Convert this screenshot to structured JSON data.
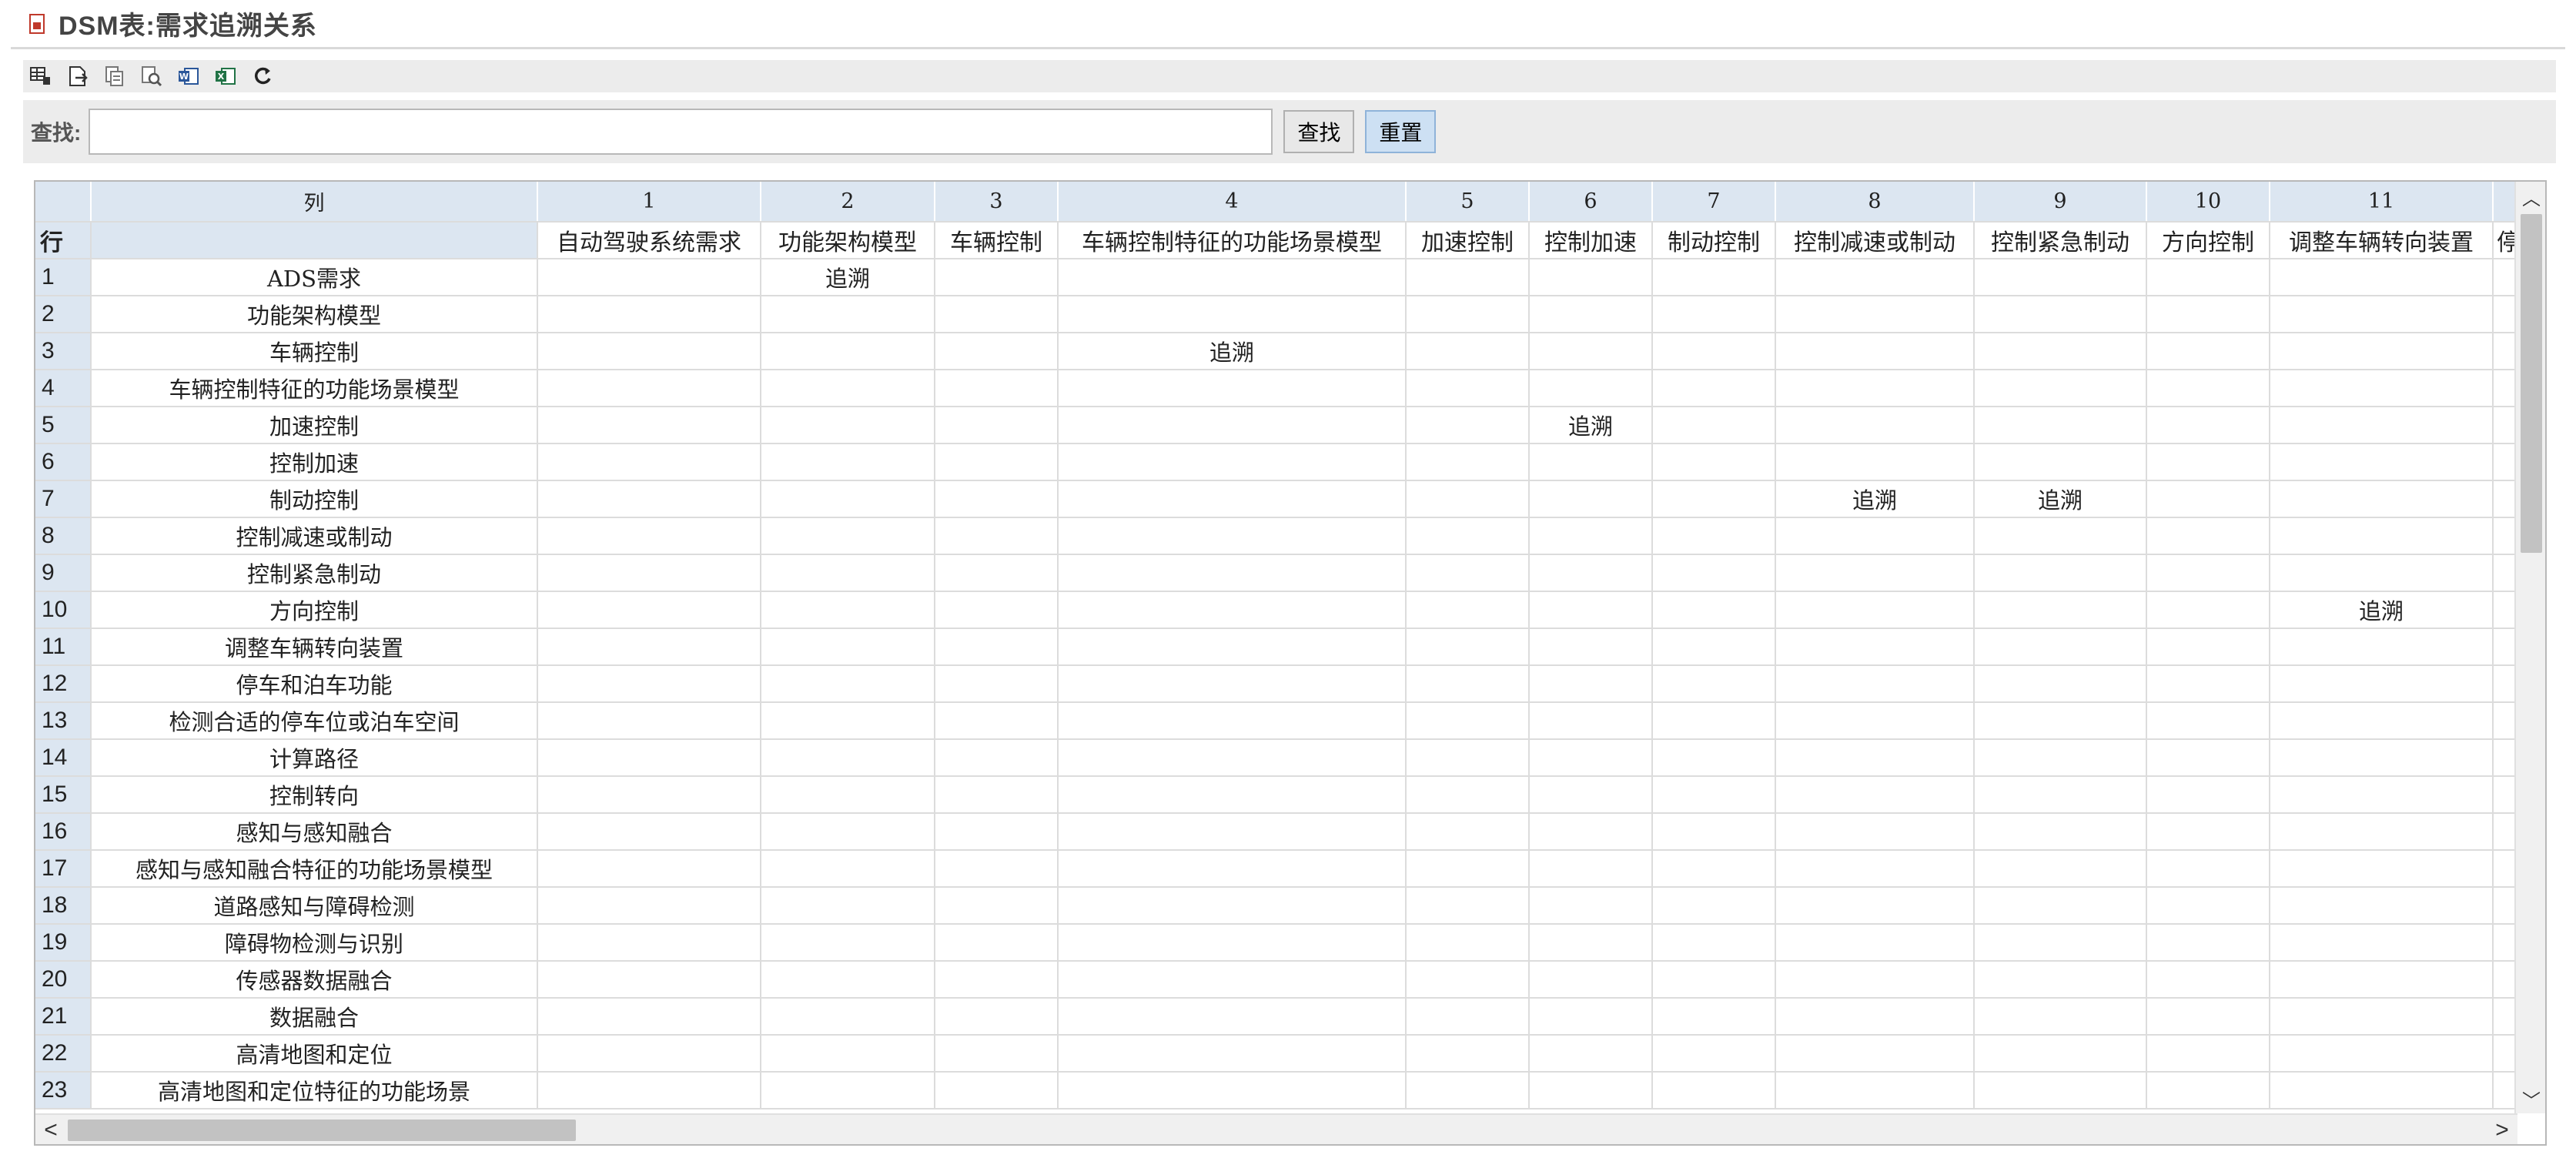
{
  "window": {
    "title": "DSM表:需求追溯关系"
  },
  "toolbar": {
    "icons": [
      "table-grid-icon",
      "export-icon",
      "copy-icon",
      "find-icon",
      "word-icon",
      "excel-icon",
      "refresh-icon"
    ]
  },
  "search": {
    "label": "查找:",
    "value": "",
    "find_label": "查找",
    "reset_label": "重置"
  },
  "grid": {
    "column_header_label": "列",
    "row_header_label": "行",
    "columns": [
      {
        "num": "1",
        "name": "自动驾驶系统需求"
      },
      {
        "num": "2",
        "name": "功能架构模型"
      },
      {
        "num": "3",
        "name": "车辆控制"
      },
      {
        "num": "4",
        "name": "车辆控制特征的功能场景模型"
      },
      {
        "num": "5",
        "name": "加速控制"
      },
      {
        "num": "6",
        "name": "控制加速"
      },
      {
        "num": "7",
        "name": "制动控制"
      },
      {
        "num": "8",
        "name": "控制减速或制动"
      },
      {
        "num": "9",
        "name": "控制紧急制动"
      },
      {
        "num": "10",
        "name": "方向控制"
      },
      {
        "num": "11",
        "name": "调整车辆转向装置"
      },
      {
        "num": "",
        "name": "停"
      }
    ],
    "rows": [
      {
        "num": "1",
        "name": "ADS需求",
        "cells": [
          "",
          "追溯",
          "",
          "",
          "",
          "",
          "",
          "",
          "",
          "",
          "",
          ""
        ]
      },
      {
        "num": "2",
        "name": "功能架构模型",
        "cells": [
          "",
          "",
          "",
          "",
          "",
          "",
          "",
          "",
          "",
          "",
          "",
          ""
        ]
      },
      {
        "num": "3",
        "name": "车辆控制",
        "cells": [
          "",
          "",
          "",
          "追溯",
          "",
          "",
          "",
          "",
          "",
          "",
          "",
          ""
        ]
      },
      {
        "num": "4",
        "name": "车辆控制特征的功能场景模型",
        "cells": [
          "",
          "",
          "",
          "",
          "",
          "",
          "",
          "",
          "",
          "",
          "",
          ""
        ]
      },
      {
        "num": "5",
        "name": "加速控制",
        "cells": [
          "",
          "",
          "",
          "",
          "",
          "追溯",
          "",
          "",
          "",
          "",
          "",
          ""
        ]
      },
      {
        "num": "6",
        "name": "控制加速",
        "cells": [
          "",
          "",
          "",
          "",
          "",
          "",
          "",
          "",
          "",
          "",
          "",
          ""
        ]
      },
      {
        "num": "7",
        "name": "制动控制",
        "cells": [
          "",
          "",
          "",
          "",
          "",
          "",
          "",
          "追溯",
          "追溯",
          "",
          "",
          ""
        ]
      },
      {
        "num": "8",
        "name": "控制减速或制动",
        "cells": [
          "",
          "",
          "",
          "",
          "",
          "",
          "",
          "",
          "",
          "",
          "",
          ""
        ]
      },
      {
        "num": "9",
        "name": "控制紧急制动",
        "cells": [
          "",
          "",
          "",
          "",
          "",
          "",
          "",
          "",
          "",
          "",
          "",
          ""
        ]
      },
      {
        "num": "10",
        "name": "方向控制",
        "cells": [
          "",
          "",
          "",
          "",
          "",
          "",
          "",
          "",
          "",
          "",
          "追溯",
          ""
        ]
      },
      {
        "num": "11",
        "name": "调整车辆转向装置",
        "cells": [
          "",
          "",
          "",
          "",
          "",
          "",
          "",
          "",
          "",
          "",
          "",
          ""
        ]
      },
      {
        "num": "12",
        "name": "停车和泊车功能",
        "cells": [
          "",
          "",
          "",
          "",
          "",
          "",
          "",
          "",
          "",
          "",
          "",
          ""
        ]
      },
      {
        "num": "13",
        "name": "检测合适的停车位或泊车空间",
        "cells": [
          "",
          "",
          "",
          "",
          "",
          "",
          "",
          "",
          "",
          "",
          "",
          ""
        ]
      },
      {
        "num": "14",
        "name": "计算路径",
        "cells": [
          "",
          "",
          "",
          "",
          "",
          "",
          "",
          "",
          "",
          "",
          "",
          ""
        ]
      },
      {
        "num": "15",
        "name": "控制转向",
        "cells": [
          "",
          "",
          "",
          "",
          "",
          "",
          "",
          "",
          "",
          "",
          "",
          ""
        ]
      },
      {
        "num": "16",
        "name": "感知与感知融合",
        "cells": [
          "",
          "",
          "",
          "",
          "",
          "",
          "",
          "",
          "",
          "",
          "",
          ""
        ]
      },
      {
        "num": "17",
        "name": "感知与感知融合特征的功能场景模型",
        "cells": [
          "",
          "",
          "",
          "",
          "",
          "",
          "",
          "",
          "",
          "",
          "",
          ""
        ]
      },
      {
        "num": "18",
        "name": "道路感知与障碍检测",
        "cells": [
          "",
          "",
          "",
          "",
          "",
          "",
          "",
          "",
          "",
          "",
          "",
          ""
        ]
      },
      {
        "num": "19",
        "name": "障碍物检测与识别",
        "cells": [
          "",
          "",
          "",
          "",
          "",
          "",
          "",
          "",
          "",
          "",
          "",
          ""
        ]
      },
      {
        "num": "20",
        "name": "传感器数据融合",
        "cells": [
          "",
          "",
          "",
          "",
          "",
          "",
          "",
          "",
          "",
          "",
          "",
          ""
        ]
      },
      {
        "num": "21",
        "name": "数据融合",
        "cells": [
          "",
          "",
          "",
          "",
          "",
          "",
          "",
          "",
          "",
          "",
          "",
          ""
        ]
      },
      {
        "num": "22",
        "name": "高清地图和定位",
        "cells": [
          "",
          "",
          "",
          "",
          "",
          "",
          "",
          "",
          "",
          "",
          "",
          ""
        ]
      },
      {
        "num": "23",
        "name": "高清地图和定位特征的功能场景",
        "cells": [
          "",
          "",
          "",
          "",
          "",
          "",
          "",
          "",
          "",
          "",
          "",
          ""
        ]
      }
    ]
  },
  "scrollbars": {
    "up": "︿",
    "down": "﹀",
    "left": "<",
    "right": ">"
  }
}
